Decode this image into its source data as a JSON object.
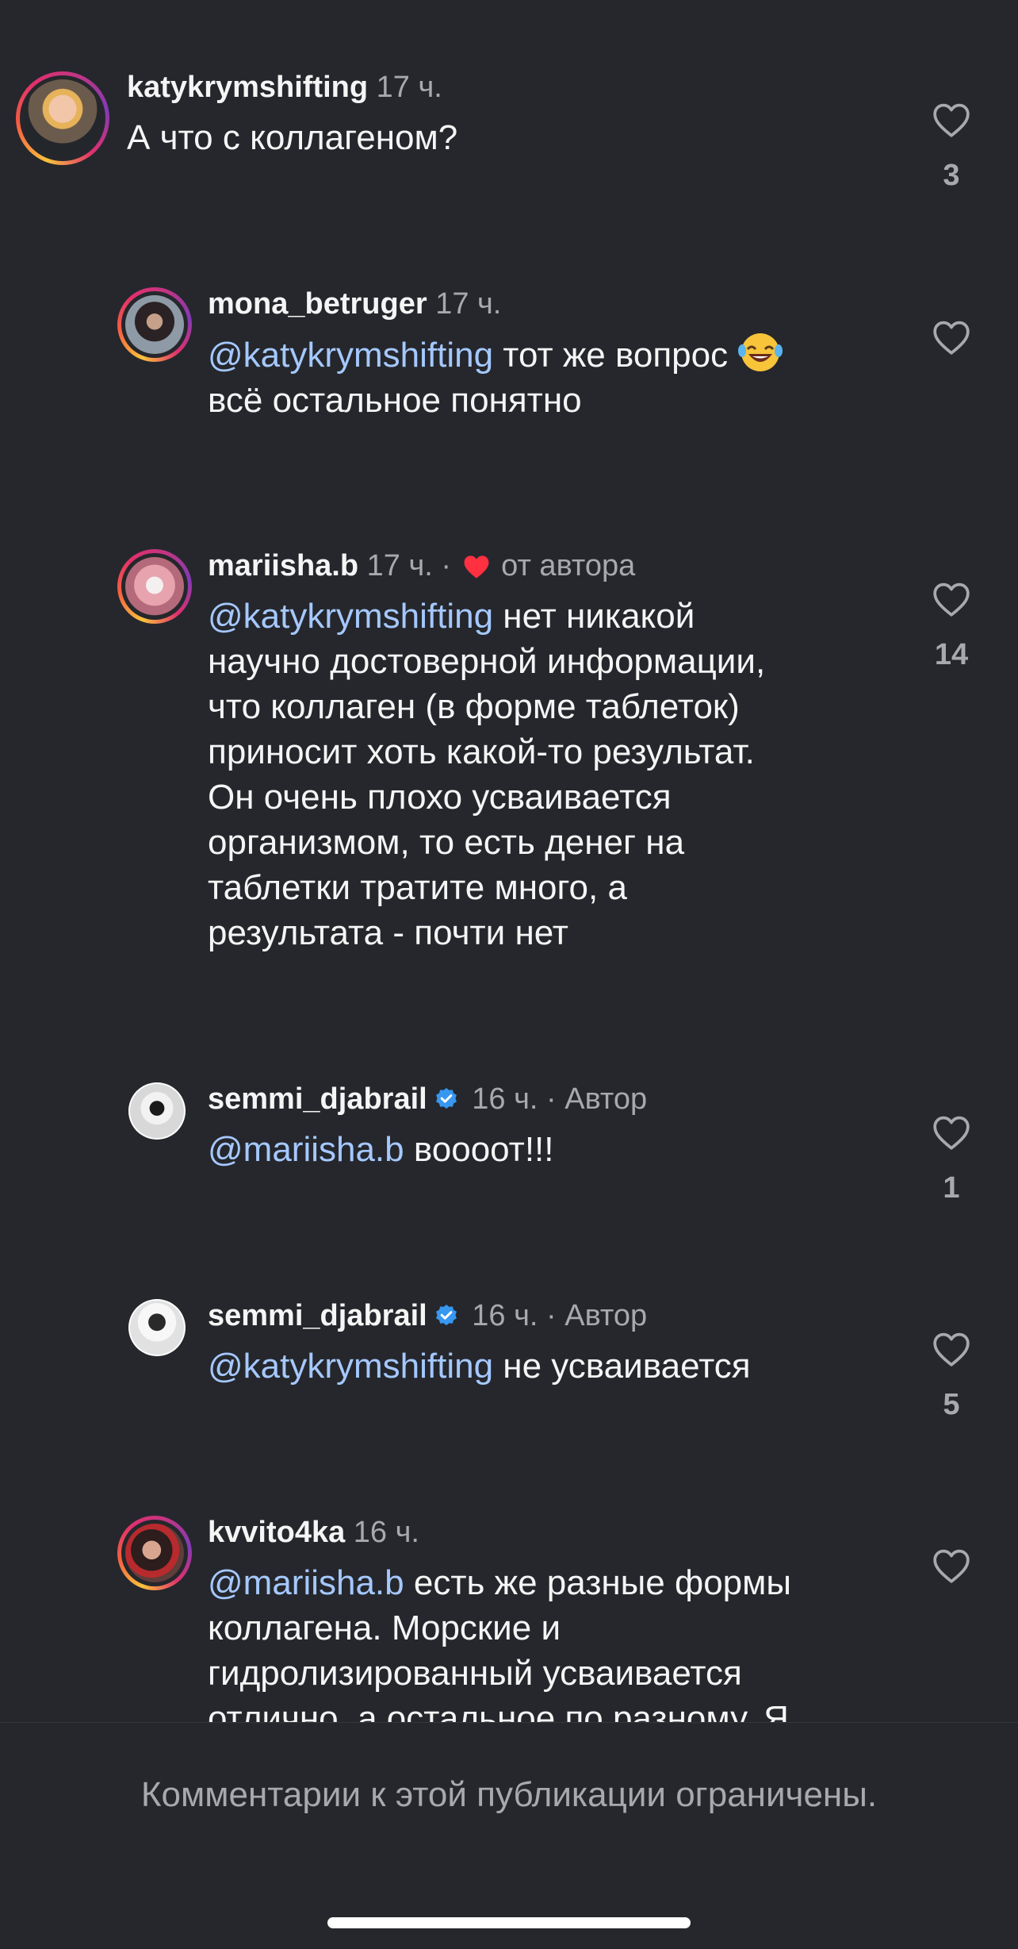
{
  "comments": [
    {
      "username": "katykrymshifting",
      "time": "17 ч.",
      "text": "А что с коллагеном?",
      "likes": "3"
    },
    {
      "username": "mona_betruger",
      "time": "17 ч.",
      "mention": "@katykrymshifting",
      "text_line1_rest": " тот же вопрос ",
      "text_line2": "всё остальное понятно"
    },
    {
      "username": "mariisha.b",
      "time": "17 ч.",
      "liked_by": "от автора",
      "mention": "@katykrymshifting",
      "lines": [
        " нет никакой",
        "научно достоверной информации,",
        "что коллаген (в форме таблеток)",
        "приносит хоть какой-то результат.",
        "Он очень плохо усваивается",
        "организмом, то есть денег на",
        "таблетки тратите много, а",
        "результата - почти нет"
      ],
      "likes": "14"
    },
    {
      "username": "semmi_djabrail",
      "time": "16 ч.",
      "role": "Автор",
      "mention": "@mariisha.b",
      "text_rest": " воооот!!!",
      "likes": "1"
    },
    {
      "username": "semmi_djabrail",
      "time": "16 ч.",
      "role": "Автор",
      "mention": "@katykrymshifting",
      "text_rest": " не усваивается",
      "likes": "5"
    },
    {
      "username": "kvvito4ka",
      "time": "16 ч.",
      "mention": "@mariisha.b",
      "lines": [
        " есть же разные формы",
        "коллагена. Морские и",
        "гидролизированный усваивается",
        "отлично, а остальное по разному. Я"
      ]
    }
  ],
  "separator": "·",
  "footer": {
    "notice": "Комментарии к этой публикации ограничены."
  },
  "colors": {
    "background": "#25272c",
    "mention": "#a5c8ff",
    "secondary_text": "#a8a8ad",
    "verified": "#3897f0",
    "heart_red": "#ff3040"
  }
}
